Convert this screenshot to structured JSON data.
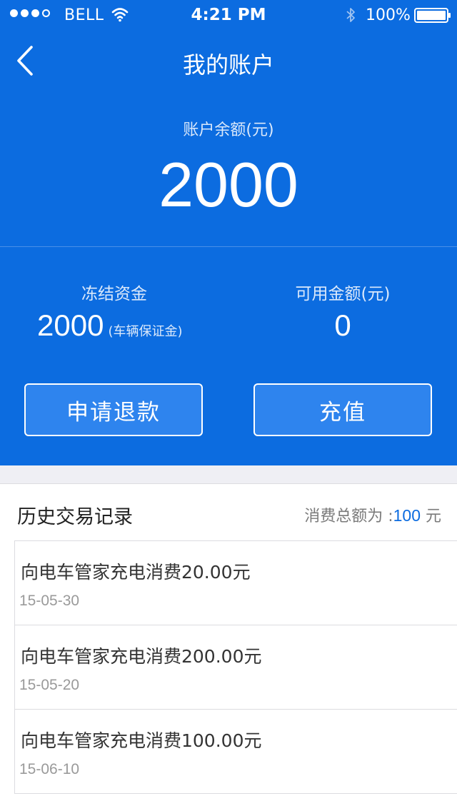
{
  "status_bar": {
    "carrier": "BELL",
    "time": "4:21 PM",
    "battery": "100%",
    "signal_bars_filled": 3,
    "signal_bars_total": 4
  },
  "nav": {
    "title": "我的账户",
    "back_icon": "chevron-left-icon"
  },
  "balance": {
    "label": "账户余额(元)",
    "value": "2000"
  },
  "frozen": {
    "label": "冻结资金",
    "value": "2000",
    "note": "(车辆保证金)"
  },
  "available": {
    "label": "可用金额(元)",
    "value": "0"
  },
  "buttons": {
    "refund": "申请退款",
    "recharge": "充值"
  },
  "history": {
    "title": "历史交易记录",
    "total_prefix": "消费总额为 :",
    "total_value": "100",
    "total_unit": " 元",
    "records": [
      {
        "title": "向电车管家充电消费20.00元",
        "date": "15-05-30"
      },
      {
        "title": "向电车管家充电消费200.00元",
        "date": "15-05-20"
      },
      {
        "title": "向电车管家充电消费100.00元",
        "date": "15-06-10"
      }
    ]
  },
  "colors": {
    "primary_blue": "#0c6ce0",
    "button_fill": "#2e84ee",
    "separator_gray": "#efeff4"
  }
}
